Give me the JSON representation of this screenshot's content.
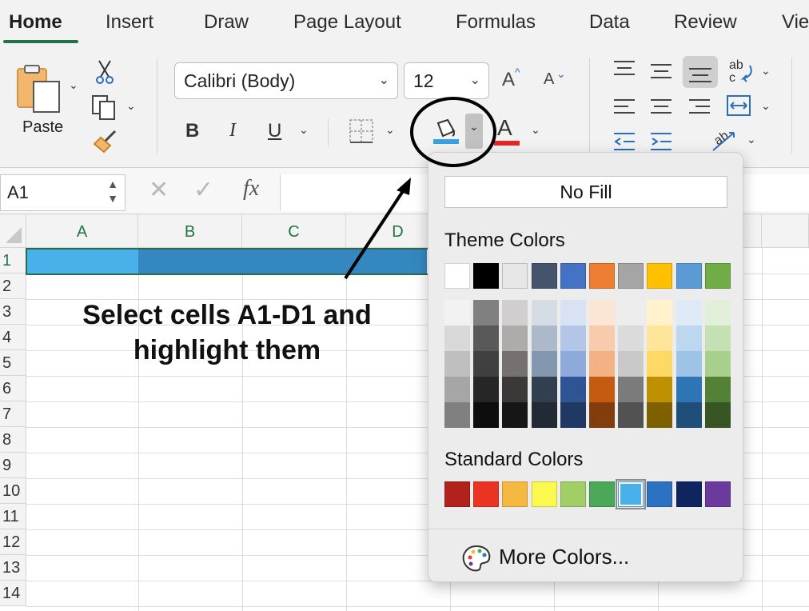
{
  "tabs": [
    {
      "label": "Home"
    },
    {
      "label": "Insert"
    },
    {
      "label": "Draw"
    },
    {
      "label": "Page Layout"
    },
    {
      "label": "Formulas"
    },
    {
      "label": "Data"
    },
    {
      "label": "Review"
    },
    {
      "label": "Vie"
    }
  ],
  "ribbon": {
    "paste_label": "Paste",
    "font_name": "Calibri (Body)",
    "font_size": "12",
    "increase_font": "A",
    "decrease_font": "A",
    "bold": "B",
    "italic": "I",
    "underline": "U",
    "font_color_letter": "A",
    "fill_color_swatch": "#3aa0e0",
    "font_color_swatch": "#e32626"
  },
  "formula_bar": {
    "name_box": "A1",
    "fx_label": "fx"
  },
  "grid": {
    "columns": [
      "A",
      "B",
      "C",
      "D"
    ],
    "rows": [
      "1",
      "2",
      "3",
      "4",
      "5",
      "6",
      "7",
      "8",
      "9",
      "10",
      "11",
      "12",
      "13",
      "14"
    ],
    "selection_fill": "#3488bf",
    "active_cell_fill": "#49b0ea"
  },
  "annotation": {
    "instruction_line1": "Select cells A1-D1 and",
    "instruction_line2": "highlight them"
  },
  "fill_popup": {
    "no_fill_label": "No Fill",
    "theme_colors_label": "Theme Colors",
    "standard_colors_label": "Standard Colors",
    "more_colors_label": "More Colors...",
    "theme_colors": [
      "#ffffff",
      "#000000",
      "#e7e6e6",
      "#44546a",
      "#4472c4",
      "#ed7d31",
      "#a5a5a5",
      "#ffc000",
      "#5b9bd5",
      "#70ad47"
    ],
    "theme_shades": [
      [
        "#f2f2f2",
        "#d9d9d9",
        "#bfbfbf",
        "#a6a6a6",
        "#808080"
      ],
      [
        "#808080",
        "#595959",
        "#404040",
        "#262626",
        "#0d0d0d"
      ],
      [
        "#d0cece",
        "#aeabab",
        "#757171",
        "#3b3838",
        "#171616"
      ],
      [
        "#d6dce4",
        "#adb9ca",
        "#8497b0",
        "#323f4f",
        "#222a35"
      ],
      [
        "#d9e2f3",
        "#b4c6e7",
        "#8eaadb",
        "#2f5496",
        "#1f3864"
      ],
      [
        "#fbe5d5",
        "#f7cbac",
        "#f4b183",
        "#c55a11",
        "#833c0b"
      ],
      [
        "#ededed",
        "#dbdbdb",
        "#c9c9c9",
        "#7b7b7b",
        "#525252"
      ],
      [
        "#fff2cc",
        "#fee599",
        "#ffd965",
        "#bf9000",
        "#7f6000"
      ],
      [
        "#deebf6",
        "#bdd7ee",
        "#9dc3e6",
        "#2e75b5",
        "#1f4e79"
      ],
      [
        "#e2efd9",
        "#c5e0b3",
        "#a8d08d",
        "#538135",
        "#375623"
      ]
    ],
    "standard_colors": [
      "#b0221b",
      "#eb3324",
      "#f5b941",
      "#fbf950",
      "#a1cf65",
      "#4aa858",
      "#49b0ea",
      "#2d71c3",
      "#0f2560",
      "#6c3a9d"
    ],
    "selected_standard_index": 6
  }
}
